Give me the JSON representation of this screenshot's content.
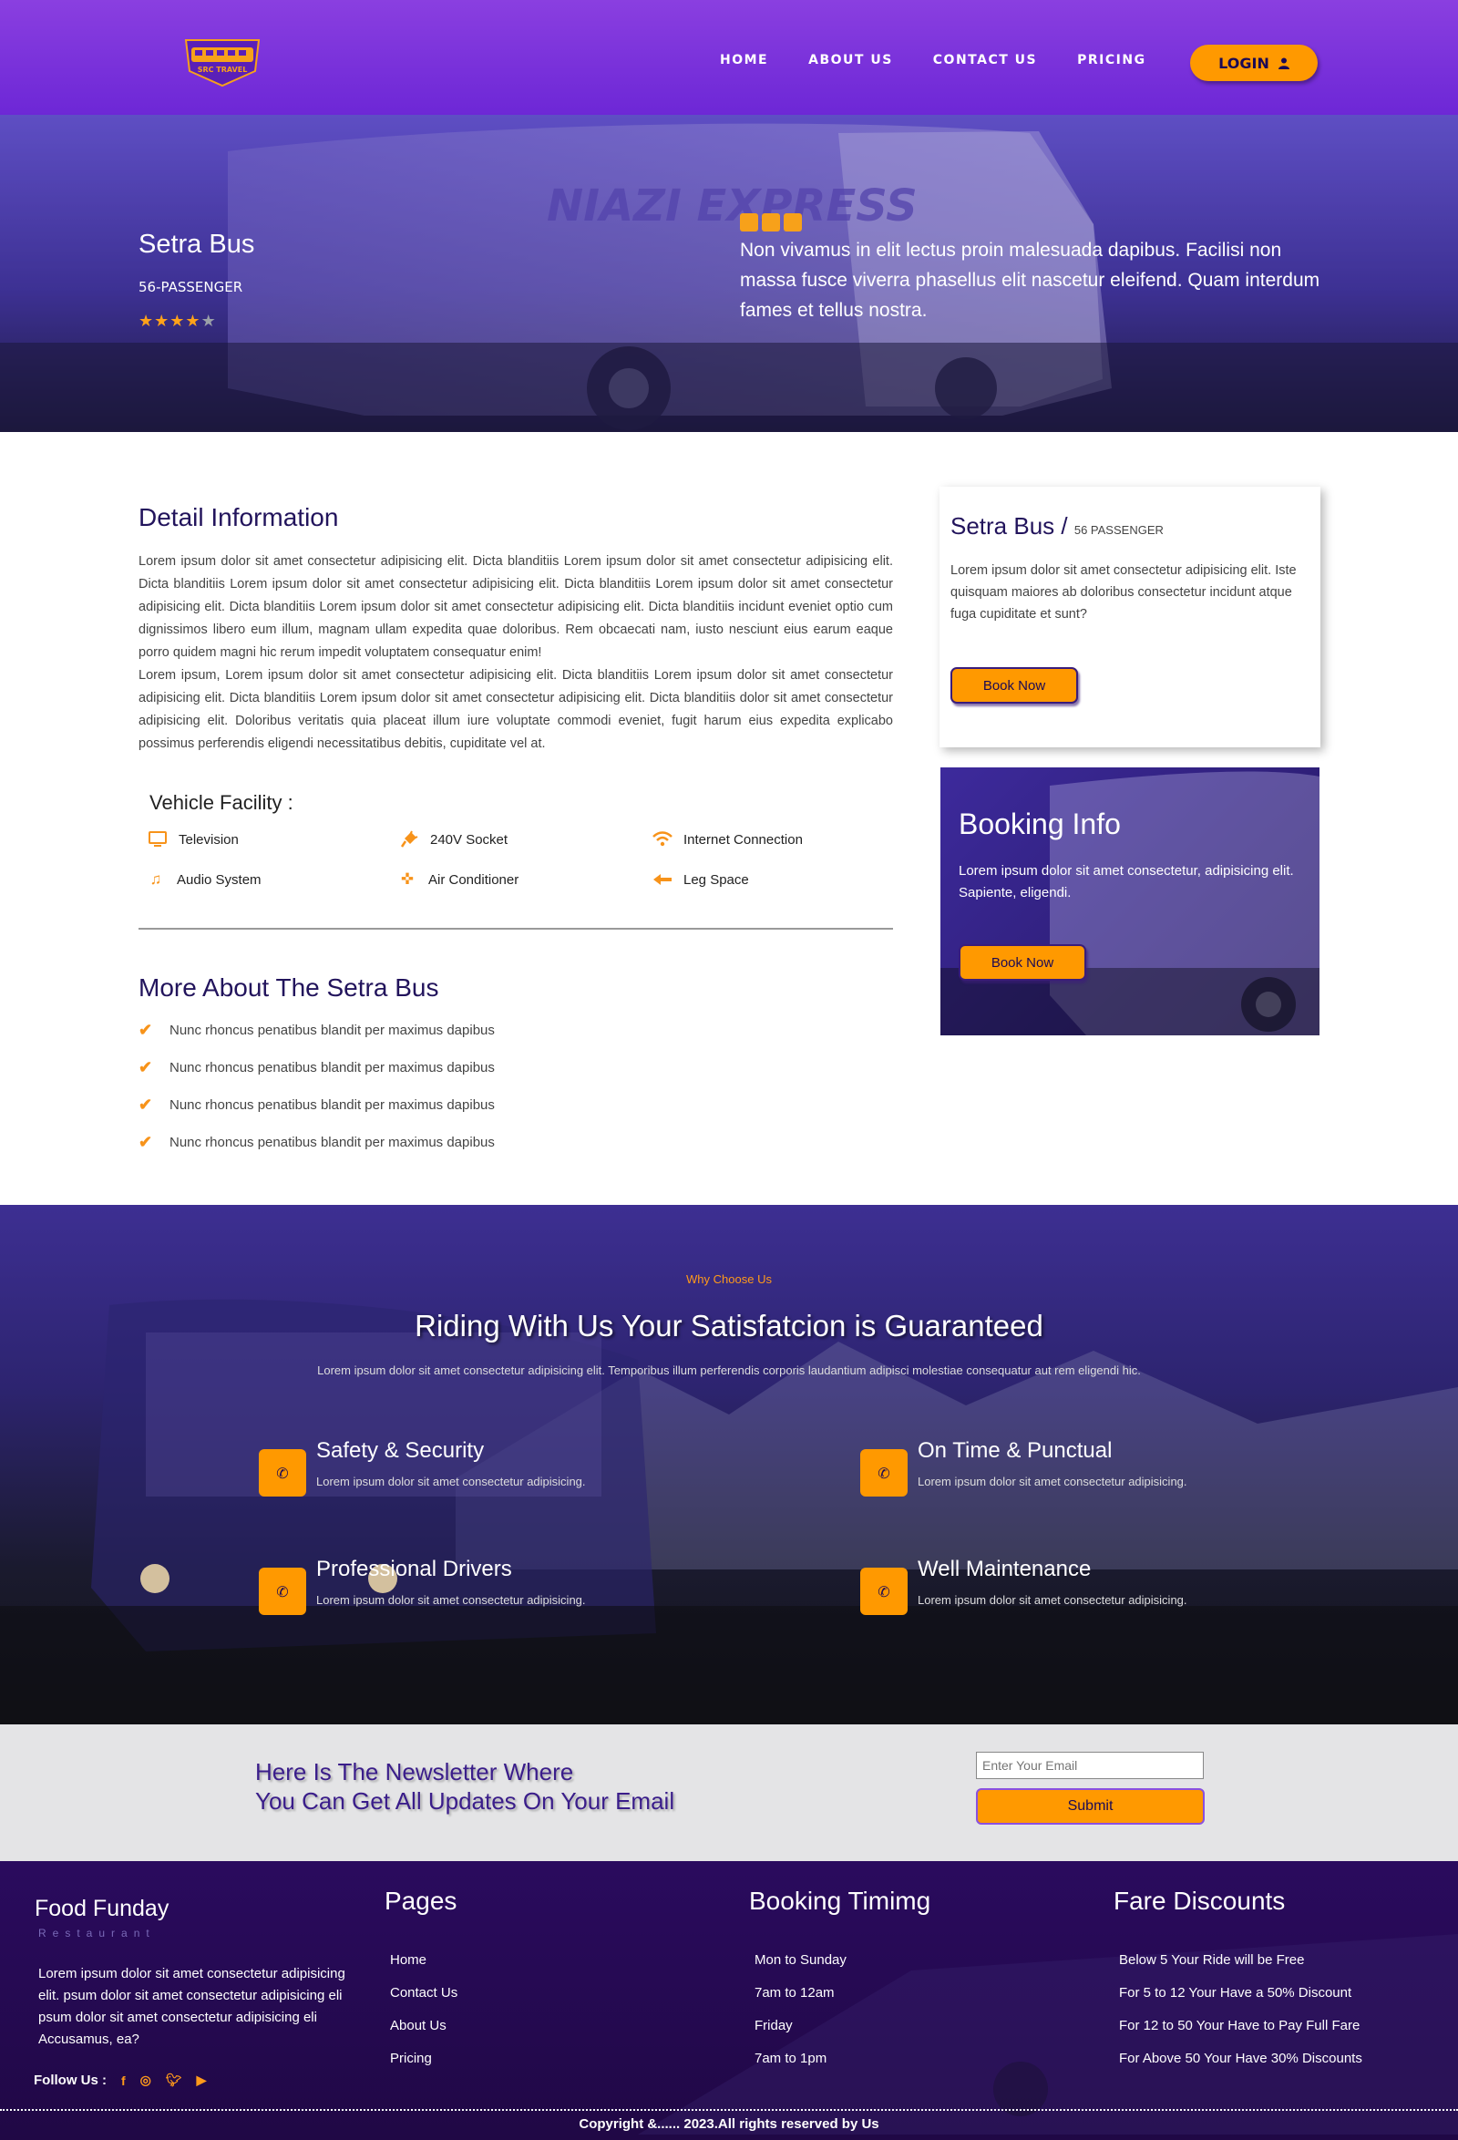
{
  "colors": {
    "primary": "#6d27d6",
    "accent": "#ff9900",
    "dark": "#22145c"
  },
  "nav": {
    "logo_text": "SRC TRAVEL",
    "links": [
      "HOME",
      "ABOUT US",
      "CONTACT US",
      "PRICING"
    ],
    "login_label": "LOGIN",
    "login_icon": "user-icon"
  },
  "hero": {
    "title": "Setra Bus",
    "subtitle": "56-PASSENGER",
    "rating": 4,
    "rating_max": 5,
    "bus_text": "NIAZI EXPRESS",
    "quote": "Non vivamus in elit lectus proin malesuada dapibus. Facilisi non massa fusce viverra phasellus elit nascetur eleifend. Quam interdum fames et tellus nostra."
  },
  "detail": {
    "title": "Detail Information",
    "paragraph1": "Lorem ipsum dolor sit amet consectetur adipisicing elit. Dicta blanditiis Lorem ipsum dolor sit amet consectetur adipisicing elit. Dicta blanditiis Lorem ipsum dolor sit amet consectetur adipisicing elit. Dicta blanditiis Lorem ipsum dolor sit amet consectetur adipisicing elit. Dicta blanditiis Lorem ipsum dolor sit amet consectetur adipisicing elit. Dicta blanditiis incidunt eveniet optio cum dignissimos libero eum illum, magnam ullam expedita quae doloribus. Rem obcaecati nam, iusto nesciunt eius earum eaque porro quidem magni hic rerum impedit voluptatem consequatur enim!",
    "paragraph2": "Lorem ipsum, Lorem ipsum dolor sit amet consectetur adipisicing elit. Dicta blanditiis Lorem ipsum dolor sit amet consectetur adipisicing elit. Dicta blanditiis Lorem ipsum dolor sit amet consectetur adipisicing elit. Dicta blanditiis dolor sit amet consectetur adipisicing elit. Doloribus veritatis quia placeat illum iure voluptate commodi eveniet, fugit harum eius expedita explicabo possimus perferendis eligendi necessitatibus debitis, cupiditate vel at.",
    "facility_title": "Vehicle Facility :",
    "facilities": [
      {
        "label": "Television",
        "icon": "tv-icon"
      },
      {
        "label": "240V Socket",
        "icon": "plug-icon"
      },
      {
        "label": "Internet Connection",
        "icon": "wifi-icon"
      },
      {
        "label": "Audio System",
        "icon": "music-icon"
      },
      {
        "label": "Air Conditioner",
        "icon": "fan-icon"
      },
      {
        "label": "Leg Space",
        "icon": "seat-icon"
      }
    ],
    "more_title": "More About The Setra Bus",
    "more_items": [
      "Nunc rhoncus penatibus blandit per maximus dapibus",
      "Nunc rhoncus penatibus blandit per maximus dapibus",
      "Nunc rhoncus penatibus blandit per maximus dapibus",
      "Nunc rhoncus penatibus blandit per maximus dapibus"
    ]
  },
  "card": {
    "title": "Setra Bus /",
    "subtitle": "56 PASSENGER",
    "text": "Lorem ipsum dolor sit amet consectetur adipisicing elit. Iste quisquam maiores ab doloribus consectetur incidunt atque fuga cupiditate et sunt?",
    "button": "Book Now"
  },
  "booking": {
    "title": "Booking Info",
    "text": "Lorem ipsum dolor sit amet consectetur, adipisicing elit. Sapiente, eligendi.",
    "button": "Book Now"
  },
  "why": {
    "kicker": "Why Choose Us",
    "title": "Riding With Us Your Satisfatcion is Guaranteed",
    "subtitle": "Lorem ipsum dolor sit amet consectetur adipisicing elit. Temporibus illum perferendis corporis laudantium adipisci molestiae consequatur aut rem eligendi hic.",
    "features": [
      {
        "title": "Safety & Security",
        "text": "Lorem ipsum dolor sit amet consectetur adipisicing."
      },
      {
        "title": "On Time & Punctual",
        "text": "Lorem ipsum dolor sit amet consectetur adipisicing."
      },
      {
        "title": "Professional Drivers",
        "text": "Lorem ipsum dolor sit amet consectetur adipisicing."
      },
      {
        "title": "Well Maintenance",
        "text": "Lorem ipsum dolor sit amet consectetur adipisicing."
      }
    ]
  },
  "newsletter": {
    "line1": "Here Is The Newsletter Where",
    "line2": "You Can Get All Updates On Your Email",
    "placeholder": "Enter Your Email",
    "button": "Submit"
  },
  "footer": {
    "brand": "Food Funday",
    "brand_sub": "Restaurant",
    "about": "Lorem ipsum dolor sit amet consectetur adipisicing elit. psum dolor sit amet consectetur adipisicing eli psum dolor sit amet consectetur adipisicing eli Accusamus, ea?",
    "follow_label": "Follow Us :",
    "socials": [
      "facebook-icon",
      "instagram-icon",
      "twitter-icon",
      "youtube-icon"
    ],
    "pages_title": "Pages",
    "pages": [
      "Home",
      "Contact Us",
      "About Us",
      "Pricing"
    ],
    "timing_title": "Booking Timimg",
    "timing": [
      "Mon to Sunday",
      "7am to 12am",
      "Friday",
      "7am to 1pm"
    ],
    "fare_title": "Fare Discounts",
    "fares": [
      "Below 5 Your Ride will be Free",
      "For 5 to 12 Your Have a 50% Discount",
      "For 12 to 50 Your Have to Pay Full Fare",
      "For Above 50 Your Have 30% Discounts"
    ],
    "copyright": "Copyright &...... 2023.All rights reserved by Us"
  }
}
